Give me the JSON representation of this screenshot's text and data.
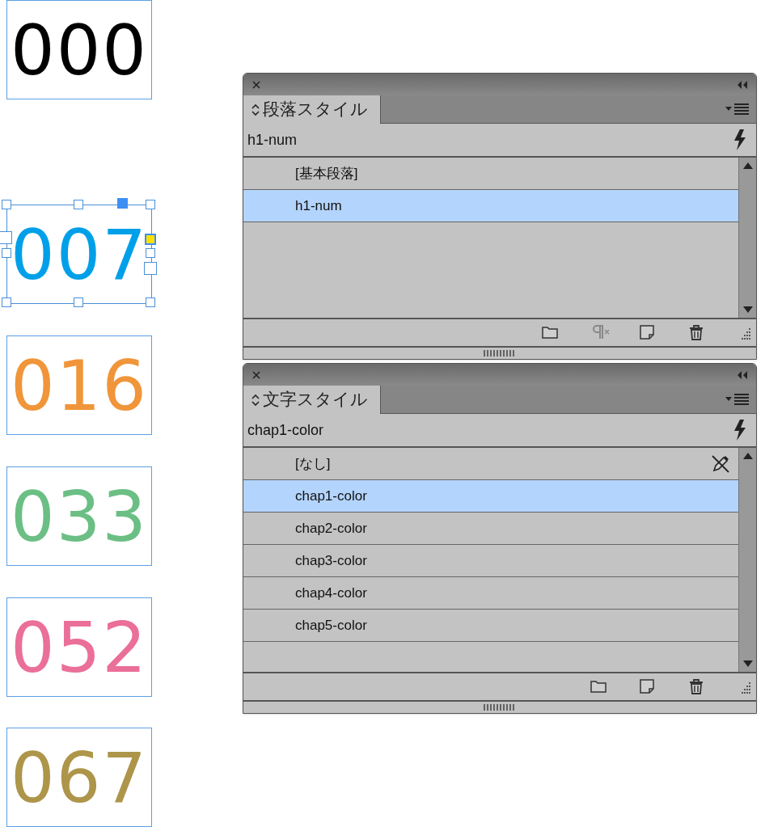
{
  "frames": [
    {
      "text": "000",
      "color": "#000000",
      "selected": false
    },
    {
      "text": "007",
      "color": "#00a0e9",
      "selected": true
    },
    {
      "text": "016",
      "color": "#f0953a",
      "selected": false
    },
    {
      "text": "033",
      "color": "#6bbf84",
      "selected": false
    },
    {
      "text": "052",
      "color": "#ea6f99",
      "selected": false
    },
    {
      "text": "067",
      "color": "#ad954a",
      "selected": false
    }
  ],
  "panels": [
    {
      "title": "段落スタイル",
      "current": "h1-num",
      "items": [
        {
          "label": "[基本段落]",
          "selected": false,
          "kind": "plain"
        },
        {
          "label": "h1-num",
          "selected": true,
          "kind": "plain"
        }
      ],
      "footer_buttons": [
        {
          "kind": "folder",
          "disabled": false
        },
        {
          "kind": "clear-overrides",
          "disabled": true
        },
        {
          "kind": "new",
          "disabled": false
        },
        {
          "kind": "delete",
          "disabled": false
        }
      ]
    },
    {
      "title": "文字スタイル",
      "current": "chap1-color",
      "items": [
        {
          "label": "[なし]",
          "selected": false,
          "kind": "locked"
        },
        {
          "label": "chap1-color",
          "selected": true,
          "kind": "plain"
        },
        {
          "label": "chap2-color",
          "selected": false,
          "kind": "plain"
        },
        {
          "label": "chap3-color",
          "selected": false,
          "kind": "plain"
        },
        {
          "label": "chap4-color",
          "selected": false,
          "kind": "plain"
        },
        {
          "label": "chap5-color",
          "selected": false,
          "kind": "plain"
        }
      ],
      "footer_buttons": [
        {
          "kind": "folder",
          "disabled": false
        },
        {
          "kind": "new",
          "disabled": false
        },
        {
          "kind": "delete",
          "disabled": false
        }
      ]
    }
  ]
}
